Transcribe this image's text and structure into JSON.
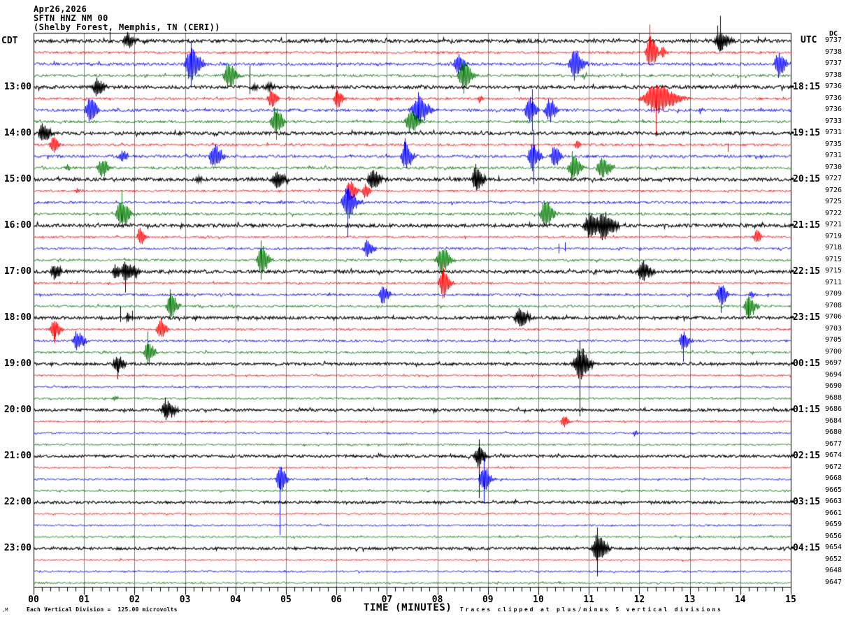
{
  "title": {
    "date": "Apr26,2026",
    "station": "SFTN HNZ NM 00",
    "location": "(Shelby Forest, Memphis, TN (CERI))"
  },
  "axis": {
    "left_header": "CDT",
    "right_header": "UTC",
    "dc_header": "DC",
    "xlabel": "TIME (MINUTES)",
    "x_tick_labels": [
      "00",
      "01",
      "02",
      "03",
      "04",
      "05",
      "06",
      "07",
      "08",
      "09",
      "10",
      "11",
      "12",
      "13",
      "14",
      "15"
    ]
  },
  "footer": {
    "corner_mark": ",M",
    "scale_note": "Each Vertical Division =  125.00 microvolts",
    "clip_note": "Traces clipped at plus/minus 5 vertical divisions"
  },
  "chart_data": {
    "type": "line",
    "subtype": "helicorder-seismogram",
    "x_range_minutes": [
      0,
      15
    ],
    "minutes_per_line": 15,
    "lines_per_hour": 4,
    "microvolts_per_division": 125.0,
    "clip_divisions": 5,
    "grid": "vertical-minute-lines",
    "grid_color": "#808080",
    "trace_colors": {
      "black": "#000000",
      "red": "#ff0000",
      "blue": "#0000ff",
      "green": "#007700"
    },
    "left_hour_labels": [
      {
        "line": 5,
        "label": "13:00"
      },
      {
        "line": 9,
        "label": "14:00"
      },
      {
        "line": 13,
        "label": "15:00"
      },
      {
        "line": 17,
        "label": "16:00"
      },
      {
        "line": 21,
        "label": "17:00"
      },
      {
        "line": 25,
        "label": "18:00"
      },
      {
        "line": 29,
        "label": "19:00"
      },
      {
        "line": 33,
        "label": "20:00"
      },
      {
        "line": 37,
        "label": "21:00"
      },
      {
        "line": 41,
        "label": "22:00"
      },
      {
        "line": 45,
        "label": "23:00"
      }
    ],
    "right_hour_labels": [
      {
        "line": 5,
        "label": "18:15"
      },
      {
        "line": 9,
        "label": "19:15"
      },
      {
        "line": 13,
        "label": "20:15"
      },
      {
        "line": 17,
        "label": "21:15"
      },
      {
        "line": 21,
        "label": "22:15"
      },
      {
        "line": 25,
        "label": "23:15"
      },
      {
        "line": 29,
        "label": "00:15"
      },
      {
        "line": 33,
        "label": "01:15"
      },
      {
        "line": 37,
        "label": "02:15"
      },
      {
        "line": 41,
        "label": "03:15"
      },
      {
        "line": 45,
        "label": "04:15"
      }
    ],
    "traces": [
      {
        "c": "black",
        "dc": 9737,
        "n": 2.2,
        "ev": [
          [
            1.85,
            12,
            0.1
          ],
          [
            13.6,
            16,
            0.12
          ]
        ],
        "sp": [
          [
            1.51,
            13,
            2
          ],
          [
            13.6,
            36,
            14
          ],
          [
            13.55,
            22,
            8
          ],
          [
            14.35,
            7,
            2
          ]
        ]
      },
      {
        "c": "red",
        "dc": 9738,
        "n": 1.6,
        "ev": [
          [
            12.2,
            24,
            0.1
          ],
          [
            12.45,
            8,
            0.06
          ]
        ],
        "sp": [
          [
            12.2,
            40,
            18
          ]
        ]
      },
      {
        "c": "blue",
        "dc": 9737,
        "n": 2.0,
        "ev": [
          [
            3.1,
            26,
            0.14
          ],
          [
            8.4,
            14,
            0.1
          ],
          [
            10.7,
            24,
            0.12
          ],
          [
            14.75,
            18,
            0.1
          ]
        ],
        "sp": [
          [
            3.12,
            34,
            34
          ]
        ]
      },
      {
        "c": "green",
        "dc": 9738,
        "n": 1.8,
        "ev": [
          [
            3.85,
            18,
            0.12
          ],
          [
            8.5,
            22,
            0.12
          ],
          [
            10.9,
            5,
            0.05
          ]
        ],
        "sp": [
          [
            8.52,
            12,
            26
          ]
        ]
      },
      {
        "c": "black",
        "dc": 9736,
        "n": 2.2,
        "ev": [
          [
            1.25,
            14,
            0.1
          ],
          [
            4.35,
            6,
            0.05
          ],
          [
            4.65,
            5,
            0.12
          ]
        ],
        "sp": [
          [
            4.28,
            30,
            10
          ]
        ]
      },
      {
        "c": "red",
        "dc": 9736,
        "n": 1.6,
        "ev": [
          [
            4.7,
            16,
            0.08
          ],
          [
            6.0,
            14,
            0.08
          ],
          [
            8.83,
            7,
            0.04
          ],
          [
            12.3,
            22,
            0.28
          ]
        ],
        "sp": [
          [
            6.0,
            18,
            8
          ],
          [
            12.32,
            20,
            50
          ]
        ]
      },
      {
        "c": "blue",
        "dc": 9736,
        "n": 2.0,
        "ev": [
          [
            1.1,
            20,
            0.1
          ],
          [
            7.6,
            22,
            0.16
          ],
          [
            9.8,
            20,
            0.1
          ],
          [
            10.2,
            18,
            0.1
          ],
          [
            13.2,
            5,
            0.04
          ]
        ],
        "sp": [
          [
            7.62,
            26,
            12
          ],
          [
            9.87,
            30,
            30
          ]
        ]
      },
      {
        "c": "green",
        "dc": 9733,
        "n": 1.8,
        "ev": [
          [
            4.78,
            22,
            0.1
          ],
          [
            7.45,
            18,
            0.12
          ]
        ],
        "sp": [
          [
            4.8,
            12,
            26
          ],
          [
            13.0,
            12,
            2
          ],
          [
            13.6,
            6,
            2
          ]
        ]
      },
      {
        "c": "black",
        "dc": 9731,
        "n": 2.2,
        "ev": [
          [
            0.17,
            14,
            0.1
          ]
        ],
        "sp": []
      },
      {
        "c": "red",
        "dc": 9735,
        "n": 1.6,
        "ev": [
          [
            0.38,
            13,
            0.08
          ],
          [
            10.75,
            6,
            0.06
          ]
        ],
        "sp": [
          [
            13.76,
            2,
            10
          ]
        ]
      },
      {
        "c": "blue",
        "dc": 9731,
        "n": 2.0,
        "ev": [
          [
            1.75,
            10,
            0.07
          ],
          [
            3.56,
            18,
            0.12
          ],
          [
            7.35,
            22,
            0.1
          ],
          [
            9.87,
            22,
            0.1
          ],
          [
            10.3,
            15,
            0.09
          ]
        ],
        "sp": [
          [
            7.35,
            26,
            10
          ],
          [
            9.9,
            38,
            40
          ]
        ]
      },
      {
        "c": "green",
        "dc": 9730,
        "n": 1.8,
        "ev": [
          [
            0.65,
            5,
            0.05
          ],
          [
            1.33,
            14,
            0.1
          ],
          [
            10.67,
            20,
            0.1
          ],
          [
            11.25,
            14,
            0.14
          ]
        ],
        "sp": [
          [
            10.67,
            24,
            10
          ]
        ]
      },
      {
        "c": "black",
        "dc": 9727,
        "n": 2.2,
        "ev": [
          [
            3.25,
            5,
            0.05
          ],
          [
            4.8,
            13,
            0.12
          ],
          [
            6.7,
            14,
            0.12
          ],
          [
            8.75,
            18,
            0.1
          ]
        ],
        "sp": [
          [
            8.75,
            22,
            10
          ]
        ]
      },
      {
        "c": "red",
        "dc": 9726,
        "n": 1.5,
        "ev": [
          [
            0.85,
            5,
            0.04
          ],
          [
            6.25,
            15,
            0.09
          ],
          [
            6.55,
            11,
            0.07
          ]
        ],
        "sp": []
      },
      {
        "c": "blue",
        "dc": 9725,
        "n": 1.8,
        "ev": [
          [
            6.2,
            26,
            0.12
          ]
        ],
        "sp": [
          [
            6.22,
            18,
            50
          ]
        ]
      },
      {
        "c": "green",
        "dc": 9722,
        "n": 1.8,
        "ev": [
          [
            1.72,
            22,
            0.12
          ],
          [
            10.12,
            20,
            0.12
          ]
        ],
        "sp": [
          [
            1.74,
            34,
            10
          ]
        ]
      },
      {
        "c": "black",
        "dc": 9721,
        "n": 2.2,
        "ev": [
          [
            11.0,
            18,
            0.14
          ],
          [
            11.25,
            20,
            0.18
          ]
        ],
        "sp": []
      },
      {
        "c": "red",
        "dc": 9719,
        "n": 1.4,
        "ev": [
          [
            2.1,
            13,
            0.08
          ],
          [
            14.3,
            11,
            0.07
          ]
        ],
        "sp": []
      },
      {
        "c": "blue",
        "dc": 9718,
        "n": 1.6,
        "ev": [
          [
            6.6,
            13,
            0.09
          ]
        ],
        "sp": [
          [
            10.4,
            7,
            7
          ],
          [
            10.52,
            9,
            4
          ]
        ]
      },
      {
        "c": "green",
        "dc": 9715,
        "n": 1.6,
        "ev": [
          [
            4.5,
            24,
            0.1
          ],
          [
            8.07,
            20,
            0.12
          ]
        ],
        "sp": [
          [
            4.5,
            28,
            28
          ]
        ]
      },
      {
        "c": "black",
        "dc": 9715,
        "n": 2.2,
        "ev": [
          [
            0.4,
            13,
            0.09
          ],
          [
            1.62,
            12,
            0.08
          ],
          [
            1.8,
            16,
            0.1
          ],
          [
            1.95,
            10,
            0.07
          ],
          [
            12.05,
            15,
            0.12
          ]
        ],
        "sp": [
          [
            1.82,
            10,
            30
          ]
        ]
      },
      {
        "c": "red",
        "dc": 9711,
        "n": 1.4,
        "ev": [
          [
            8.1,
            22,
            0.1
          ]
        ],
        "sp": [
          [
            8.1,
            30,
            22
          ]
        ]
      },
      {
        "c": "blue",
        "dc": 9709,
        "n": 1.6,
        "ev": [
          [
            6.9,
            13,
            0.1
          ],
          [
            13.6,
            15,
            0.1
          ],
          [
            14.2,
            6,
            0.05
          ]
        ],
        "sp": [
          [
            13.62,
            10,
            26
          ]
        ]
      },
      {
        "c": "green",
        "dc": 9708,
        "n": 1.6,
        "ev": [
          [
            2.7,
            18,
            0.1
          ],
          [
            14.15,
            18,
            0.1
          ]
        ],
        "sp": [
          [
            2.7,
            24,
            10
          ],
          [
            14.15,
            12,
            16
          ]
        ]
      },
      {
        "c": "black",
        "dc": 9706,
        "n": 2.0,
        "ev": [
          [
            1.85,
            6,
            0.05
          ],
          [
            9.62,
            16,
            0.12
          ]
        ],
        "sp": [
          [
            1.72,
            16,
            6
          ],
          [
            1.95,
            10,
            4
          ]
        ]
      },
      {
        "c": "red",
        "dc": 9703,
        "n": 1.4,
        "ev": [
          [
            0.4,
            15,
            0.09
          ],
          [
            2.5,
            14,
            0.09
          ]
        ],
        "sp": [
          [
            0.42,
            12,
            20
          ]
        ]
      },
      {
        "c": "blue",
        "dc": 9705,
        "n": 1.5,
        "ev": [
          [
            0.85,
            15,
            0.1
          ],
          [
            12.85,
            14,
            0.09
          ]
        ],
        "sp": [
          [
            12.87,
            8,
            30
          ]
        ]
      },
      {
        "c": "green",
        "dc": 9700,
        "n": 1.5,
        "ev": [
          [
            2.25,
            18,
            0.09
          ]
        ],
        "sp": [
          [
            2.26,
            30,
            12
          ]
        ]
      },
      {
        "c": "black",
        "dc": 9697,
        "n": 1.8,
        "ev": [
          [
            1.65,
            13,
            0.1
          ],
          [
            10.8,
            26,
            0.14
          ]
        ],
        "sp": [
          [
            1.66,
            8,
            22
          ],
          [
            10.82,
            34,
            75
          ]
        ]
      },
      {
        "c": "red",
        "dc": 9694,
        "n": 1.2,
        "ev": [],
        "sp": []
      },
      {
        "c": "blue",
        "dc": 9690,
        "n": 1.3,
        "ev": [],
        "sp": []
      },
      {
        "c": "green",
        "dc": 9688,
        "n": 1.3,
        "ev": [
          [
            1.6,
            4,
            0.05
          ]
        ],
        "sp": []
      },
      {
        "c": "black",
        "dc": 9686,
        "n": 1.8,
        "ev": [
          [
            2.62,
            15,
            0.12
          ]
        ],
        "sp": [
          [
            2.6,
            18,
            8
          ]
        ]
      },
      {
        "c": "red",
        "dc": 9684,
        "n": 1.2,
        "ev": [
          [
            10.5,
            9,
            0.07
          ]
        ],
        "sp": []
      },
      {
        "c": "blue",
        "dc": 9680,
        "n": 1.2,
        "ev": [
          [
            11.9,
            4,
            0.04
          ]
        ],
        "sp": []
      },
      {
        "c": "green",
        "dc": 9677,
        "n": 1.2,
        "ev": [],
        "sp": []
      },
      {
        "c": "black",
        "dc": 9674,
        "n": 1.8,
        "ev": [
          [
            8.8,
            18,
            0.1
          ]
        ],
        "sp": [
          [
            8.82,
            24,
            60
          ]
        ]
      },
      {
        "c": "red",
        "dc": 9672,
        "n": 1.1,
        "ev": [],
        "sp": []
      },
      {
        "c": "blue",
        "dc": 9668,
        "n": 1.3,
        "ev": [
          [
            4.87,
            20,
            0.09
          ],
          [
            8.9,
            20,
            0.1
          ]
        ],
        "sp": [
          [
            4.88,
            18,
            80
          ],
          [
            8.92,
            30,
            35
          ]
        ]
      },
      {
        "c": "green",
        "dc": 9665,
        "n": 1.2,
        "ev": [],
        "sp": []
      },
      {
        "c": "black",
        "dc": 9663,
        "n": 1.8,
        "ev": [],
        "sp": []
      },
      {
        "c": "red",
        "dc": 9661,
        "n": 1.1,
        "ev": [],
        "sp": []
      },
      {
        "c": "blue",
        "dc": 9659,
        "n": 1.2,
        "ev": [],
        "sp": []
      },
      {
        "c": "green",
        "dc": 9656,
        "n": 1.2,
        "ev": [],
        "sp": []
      },
      {
        "c": "black",
        "dc": 9654,
        "n": 1.8,
        "ev": [
          [
            11.15,
            22,
            0.12
          ]
        ],
        "sp": [
          [
            11.17,
            30,
            40
          ]
        ]
      },
      {
        "c": "red",
        "dc": 9652,
        "n": 1.1,
        "ev": [],
        "sp": []
      },
      {
        "c": "blue",
        "dc": 9648,
        "n": 1.2,
        "ev": [],
        "sp": []
      },
      {
        "c": "green",
        "dc": 9647,
        "n": 1.2,
        "ev": [],
        "sp": []
      }
    ]
  }
}
